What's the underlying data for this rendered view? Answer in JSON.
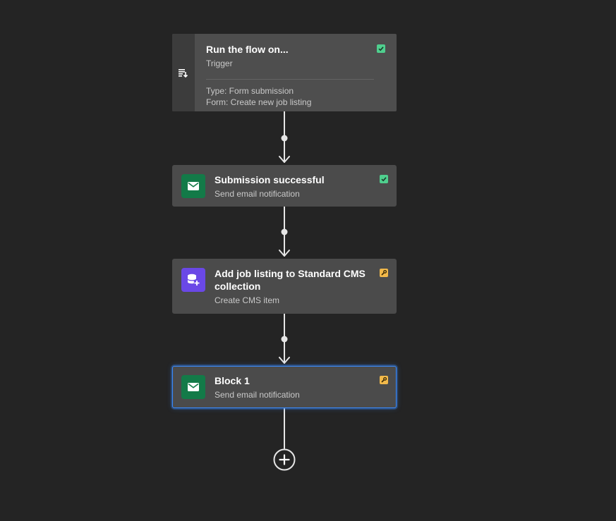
{
  "trigger": {
    "title": "Run the flow on...",
    "subtitle": "Trigger",
    "type_line": "Type: Form submission",
    "form_line": "Form: Create new job listing",
    "icon": "form-download-icon",
    "status": "complete"
  },
  "steps": [
    {
      "title": "Submission successful",
      "subtitle": "Send email notification",
      "icon": "mail-icon",
      "status": "complete"
    },
    {
      "title": "Add job listing to Standard CMS collection",
      "subtitle": "Create CMS item",
      "icon": "database-add-icon",
      "status": "needs-config"
    },
    {
      "title": "Block 1",
      "subtitle": "Send email notification",
      "icon": "mail-icon",
      "status": "needs-config",
      "selected": true
    }
  ],
  "add_button": {
    "icon": "plus-circle-icon"
  },
  "colors": {
    "canvas": "#242424",
    "node": "#4b4b4b",
    "status_complete": "#4fcf8e",
    "status_warning": "#f2b94a",
    "email_icon_bg": "#137a48",
    "cms_icon_bg": "#6a48e6",
    "selection": "#3b8cff"
  }
}
